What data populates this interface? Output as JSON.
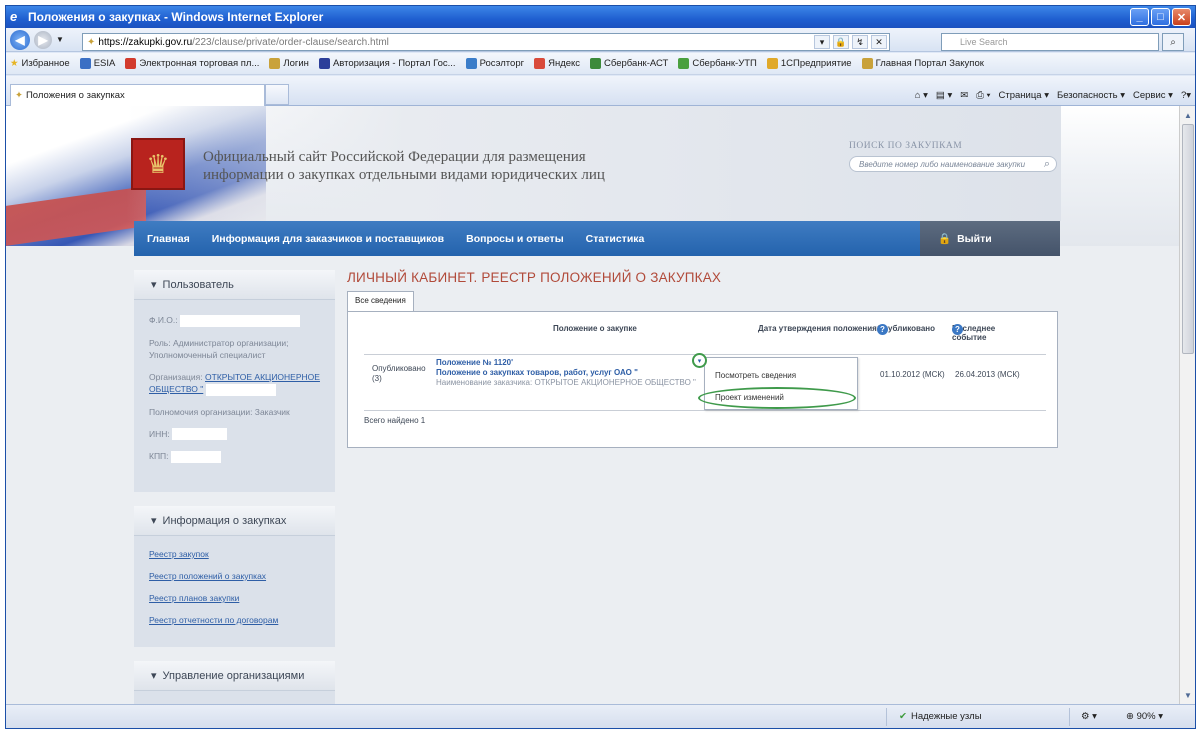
{
  "window": {
    "title": "Положения о закупках - Windows Internet Explorer"
  },
  "address": {
    "host": "https://zakupki.gov.ru",
    "path": "/223/clause/private/order-clause/search.html"
  },
  "live_search": {
    "placeholder": "Live Search"
  },
  "favorites": {
    "label": "Избранное",
    "items": [
      {
        "label": "ESIA",
        "color": "#3a6fc4"
      },
      {
        "label": "Электронная торговая пл...",
        "color": "#d23b2d"
      },
      {
        "label": "Логин",
        "color": "#c9a23a"
      },
      {
        "label": "Авторизация - Портал Гос...",
        "color": "#2c3f9a"
      },
      {
        "label": "Росэлторг",
        "color": "#3b7dc9"
      },
      {
        "label": "Яндекс",
        "color": "#d94a3a"
      },
      {
        "label": "Сбербанк-АСТ",
        "color": "#3c8a3a"
      },
      {
        "label": "Сбербанк-УТП",
        "color": "#4aa03f"
      },
      {
        "label": "1СПредприятие",
        "color": "#e0a92a"
      },
      {
        "label": "Главная Портал Закупок",
        "color": "#c9a23a"
      }
    ]
  },
  "tab": {
    "label": "Положения о закупках"
  },
  "commands": {
    "page": "Страница ▾",
    "safety": "Безопасность ▾",
    "tools": "Сервис ▾",
    "help": "?▾"
  },
  "site": {
    "title": "Официальный сайт Российской Федерации для размещения информации о закупках отдельными видами юридических лиц",
    "search_label": "ПОИСК ПО ЗАКУПКАМ",
    "search_placeholder": "Введите номер либо наименование закупки",
    "nav": [
      "Главная",
      "Информация для заказчиков и поставщиков",
      "Вопросы и ответы",
      "Статистика"
    ],
    "logout": "Выйти"
  },
  "sidebar": {
    "user": {
      "title": "Пользователь",
      "fio_label": "Ф.И.О.:",
      "role": "Роль: Администратор организации; Уполномоченный специалист",
      "org_label": "Организация:",
      "org_link": "ОТКРЫТОЕ АКЦИОНЕРНОЕ ОБЩЕСТВО \"",
      "powers": "Полномочия организации: Заказчик",
      "inn_label": "ИНН:",
      "kpp_label": "КПП:"
    },
    "info": {
      "title": "Информация о закупках",
      "links": [
        "Реестр закупок",
        "Реестр положений о закупках",
        "Реестр планов закупки",
        "Реестр отчетности по договорам"
      ]
    },
    "org": {
      "title": "Управление организациями"
    }
  },
  "main": {
    "heading": "ЛИЧНЫЙ КАБИНЕТ. РЕЕСТР ПОЛОЖЕНИЙ О ЗАКУПКАХ",
    "tab": "Все сведения",
    "columns": {
      "regulation": "Положение о закупке",
      "approval_date": "Дата утверждения положения",
      "published": "Опубликовано",
      "last_event": "Последнее событие"
    },
    "row": {
      "status": "Опубликовано",
      "status_count": "(3)",
      "title_line1": "Положение № 1120'",
      "title_line2": "Положение о закупках товаров, работ, услуг ОАО \"",
      "customer": "Наименование заказчика: ОТКРЫТОЕ АКЦИОНЕРНОЕ ОБЩЕСТВО \"",
      "published": "01.10.2012 (МСК)",
      "last_event": "26.04.2013 (МСК)"
    },
    "menu": [
      "Посмотреть сведения",
      "Проект изменений"
    ],
    "found": "Всего найдено 1"
  },
  "status": {
    "zone": "Надежные узлы",
    "zoom": "90%"
  }
}
